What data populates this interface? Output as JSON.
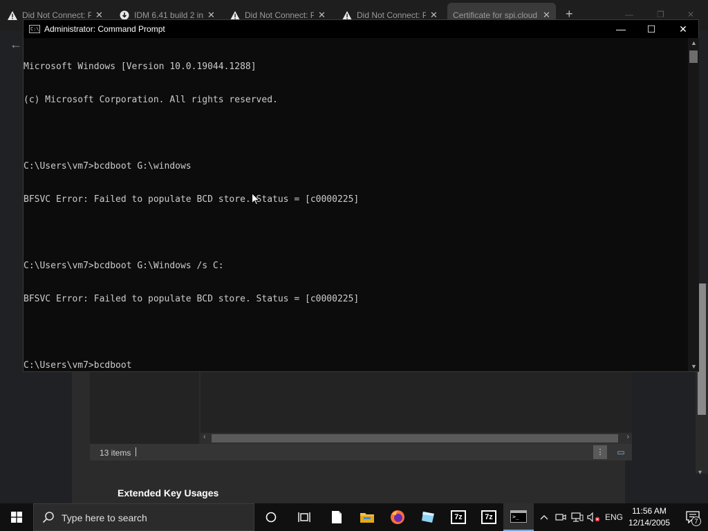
{
  "browser": {
    "tabs": [
      {
        "title": "Did Not Connect: P",
        "icon": "warning-icon",
        "active": false
      },
      {
        "title": "IDM 6.41 build 2 in",
        "icon": "download-icon",
        "active": false
      },
      {
        "title": "Did Not Connect: P",
        "icon": "warning-icon",
        "active": false
      },
      {
        "title": "Did Not Connect: P",
        "icon": "warning-icon",
        "active": false
      },
      {
        "title": "Certificate for spi.cloud",
        "icon": "",
        "active": true
      }
    ],
    "new_tab": "+"
  },
  "cert_viewer": {
    "items_count": "13 items",
    "section_heading": "Extended Key Usages"
  },
  "cmd": {
    "title": "Administrator: Command Prompt",
    "controls": {
      "minimize": "—",
      "maximize": "☐",
      "close": "✕"
    },
    "lines": [
      "Microsoft Windows [Version 10.0.19044.1288]",
      "(c) Microsoft Corporation. All rights reserved.",
      "",
      "C:\\Users\\vm7>bcdboot G:\\windows",
      "BFSVC Error: Failed to populate BCD store. Status = [c0000225]",
      "",
      "C:\\Users\\vm7>bcdboot G:\\Windows /s C:",
      "BFSVC Error: Failed to populate BCD store. Status = [c0000225]",
      "",
      "C:\\Users\\vm7>bcdboot"
    ]
  },
  "taskbar": {
    "search_placeholder": "Type here to search",
    "pinned": [
      "cortana-icon",
      "task-view-icon",
      "notepad-icon",
      "file-explorer-icon",
      "firefox-icon",
      "app-icon",
      "7zip-icon",
      "7zip-icon",
      "command-prompt-icon"
    ],
    "seven_zip_label": "7z",
    "tray": {
      "language": "ENG"
    },
    "clock": {
      "time": "11:56 AM",
      "date": "12/14/2005"
    },
    "notifications_count": "7"
  },
  "colors": {
    "console_bg": "#0c0c0c",
    "console_text": "#cccccc",
    "taskbar_bg": "#101010",
    "accent": "#7aa7d6"
  }
}
